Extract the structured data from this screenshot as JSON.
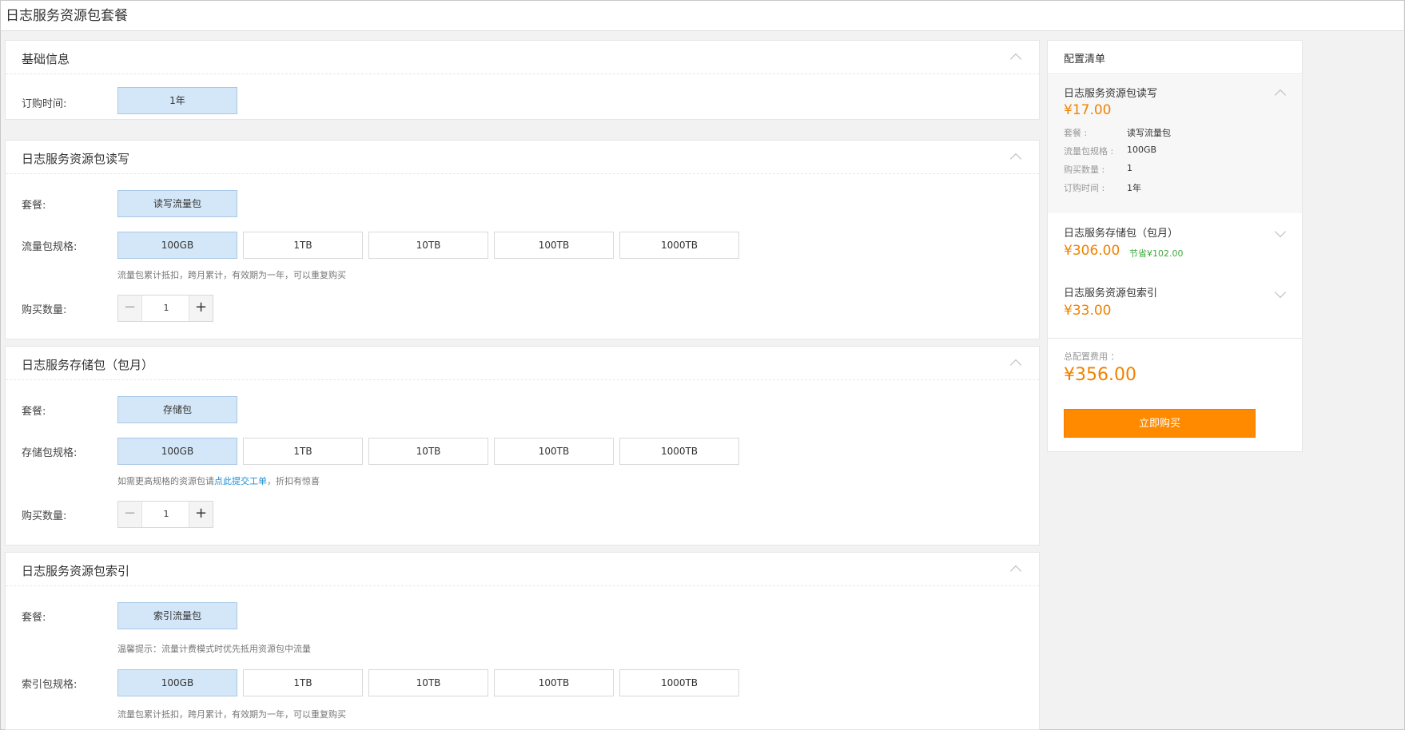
{
  "page": {
    "title": "日志服务资源包套餐"
  },
  "basic": {
    "title": "基础信息",
    "duration_label": "订购时间:",
    "duration_value": "1年"
  },
  "rw": {
    "title": "日志服务资源包读写",
    "plan_label": "套餐:",
    "plan_value": "读写流量包",
    "spec_label": "流量包规格:",
    "specs": [
      "100GB",
      "1TB",
      "10TB",
      "100TB",
      "1000TB"
    ],
    "selected_spec": "100GB",
    "note": "流量包累计抵扣，跨月累计，有效期为一年，可以重复购买",
    "qty_label": "购买数量:",
    "qty": "1"
  },
  "storage": {
    "title": "日志服务存储包（包月）",
    "plan_label": "套餐:",
    "plan_value": "存储包",
    "spec_label": "存储包规格:",
    "specs": [
      "100GB",
      "1TB",
      "10TB",
      "100TB",
      "1000TB"
    ],
    "selected_spec": "100GB",
    "note_prefix": "如需更高规格的资源包请",
    "note_link": "点此提交工单",
    "note_suffix": "，折扣有惊喜",
    "qty_label": "购买数量:",
    "qty": "1"
  },
  "index": {
    "title": "日志服务资源包索引",
    "plan_label": "套餐:",
    "plan_value": "索引流量包",
    "tip": "温馨提示：流量计费模式时优先抵用资源包中流量",
    "spec_label": "索引包规格:",
    "specs": [
      "100GB",
      "1TB",
      "10TB",
      "100TB",
      "1000TB"
    ],
    "selected_spec": "100GB",
    "note": "流量包累计抵扣，跨月累计，有效期为一年，可以重复购买"
  },
  "summary": {
    "title": "配置清单",
    "items": [
      {
        "name": "日志服务资源包读写",
        "price": "¥17.00",
        "details": [
          {
            "k": "套餐 :",
            "v": "读写流量包"
          },
          {
            "k": "流量包规格 :",
            "v": "100GB"
          },
          {
            "k": "购买数量 :",
            "v": "1"
          },
          {
            "k": "订购时间 :",
            "v": "1年"
          }
        ]
      },
      {
        "name": "日志服务存储包（包月）",
        "price": "¥306.00",
        "save": "节省¥102.00"
      },
      {
        "name": "日志服务资源包索引",
        "price": "¥33.00"
      }
    ],
    "total_label": "总配置费用 ：",
    "total_value": "¥356.00",
    "buy_label": "立即购买"
  },
  "colors": {
    "accent": "#ff8a00",
    "price": "#f08200",
    "selected": "#d4e7f8",
    "link": "#1f8ed6",
    "save": "#3da83d"
  }
}
